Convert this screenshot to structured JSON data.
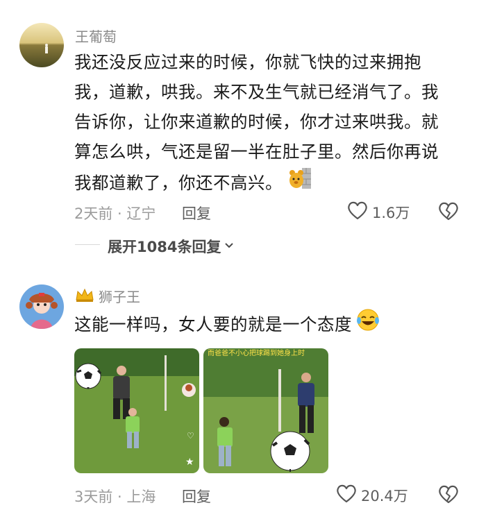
{
  "comment1": {
    "username": "王葡萄",
    "lines": [
      "我还没反应过来的时候，你就飞快的过来拥抱",
      "我，道歉，哄我。来不及生气就已经消气了。我",
      "告诉你，让你来道歉的时候，你才过来哄我。就",
      "算怎么哄，气还是留一半在肚子里。然后你再说",
      "我都道歉了，你还不高兴。"
    ],
    "time_location": "2天前 · 辽宁",
    "reply_label": "回复",
    "likes": "1.6万",
    "expand_label": "展开1084条回复"
  },
  "comment2": {
    "username": "狮子王",
    "text": "这能一样吗，女人要的就是一个态度",
    "media_caption": "而爸爸不小心把球踢到她身上时",
    "time_location": "3天前 · 上海",
    "reply_label": "回复",
    "likes": "20.4万"
  },
  "colors": {
    "grass": "#6f9a3c",
    "trees": "#3f6b2a",
    "sky": "#dfe9d8"
  }
}
